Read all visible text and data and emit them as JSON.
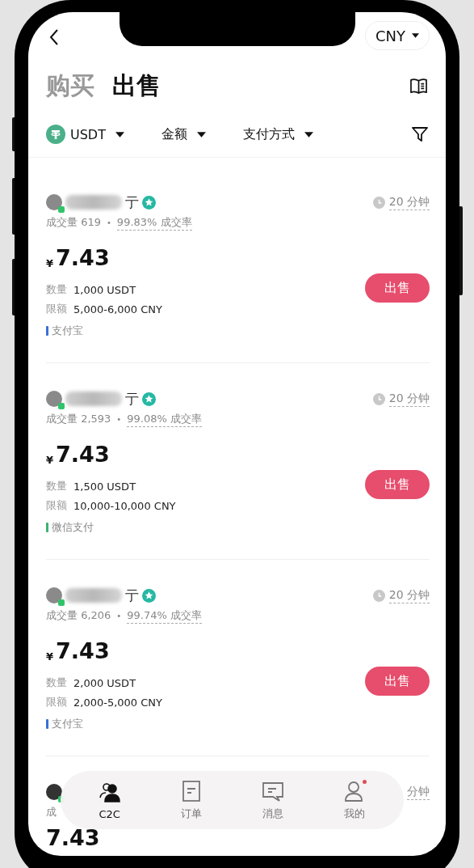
{
  "header": {
    "currency": "CNY"
  },
  "tabs": [
    {
      "label": "购买",
      "selected": false
    },
    {
      "label": "出售",
      "selected": true
    }
  ],
  "filters": [
    {
      "label": "USDT",
      "kind": "coin"
    },
    {
      "label": "金额",
      "kind": "plain"
    },
    {
      "label": "支付方式",
      "kind": "plain"
    }
  ],
  "offers": [
    {
      "name_visible": "亍",
      "verified": true,
      "trades": "成交量 619",
      "separator": "•",
      "rate": "99.83% 成交率",
      "time": "20 分钟",
      "currency": "¥",
      "price": "7.43",
      "qty_label": "数量",
      "qty": "1,000 USDT",
      "limit_label": "限额",
      "limit": "5,000-6,000 CNY",
      "payment": {
        "label": "支付宝",
        "color": "#3b6fd6"
      },
      "action": "出售"
    },
    {
      "name_visible": "亍",
      "verified": true,
      "trades": "成交量 2,593",
      "separator": "•",
      "rate": "99.08% 成交率",
      "time": "20 分钟",
      "currency": "¥",
      "price": "7.43",
      "qty_label": "数量",
      "qty": "1,500 USDT",
      "limit_label": "限额",
      "limit": "10,000-10,000 CNY",
      "payment": {
        "label": "微信支付",
        "color": "#3cb371"
      },
      "action": "出售"
    },
    {
      "name_visible": "亍",
      "verified": true,
      "trades": "成交量 6,206",
      "separator": "•",
      "rate": "99.74% 成交率",
      "time": "20 分钟",
      "currency": "¥",
      "price": "7.43",
      "qty_label": "数量",
      "qty": "2,000 USDT",
      "limit_label": "限额",
      "limit": "2,000-5,000 CNY",
      "payment": {
        "label": "支付宝",
        "color": "#3b6fd6"
      },
      "action": "出售"
    }
  ],
  "partial_offer": {
    "trades": "成",
    "time": "分钟",
    "price": "7.43"
  },
  "nav": [
    {
      "label": "C2C",
      "kind": "people",
      "selected": true,
      "badge": false
    },
    {
      "label": "订单",
      "kind": "order",
      "selected": false,
      "badge": false
    },
    {
      "label": "消息",
      "kind": "message",
      "selected": false,
      "badge": false
    },
    {
      "label": "我的",
      "kind": "person",
      "selected": false,
      "badge": true
    }
  ]
}
